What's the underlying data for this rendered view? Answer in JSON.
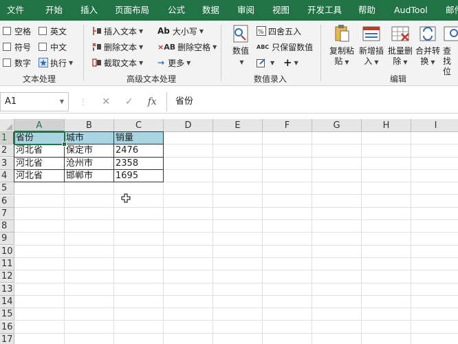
{
  "tabs": [
    "文件",
    "开始",
    "插入",
    "页面布局",
    "公式",
    "数据",
    "审阅",
    "视图",
    "开发工具",
    "帮助",
    "AudTool",
    "邮件"
  ],
  "ribbon": {
    "text_group": {
      "items": [
        "空格",
        "英文",
        "符号",
        "中文",
        "数字",
        "执行"
      ],
      "label": "文本处理"
    },
    "advanced_group": {
      "items": [
        "插入文本",
        "大小写",
        "删除文本",
        "删除空格",
        "截取文本",
        "更多"
      ],
      "label": "高级文本处理"
    },
    "input_group": {
      "big": "数值",
      "items": [
        "四舍五入",
        "只保留数值"
      ],
      "label": "数值录入"
    },
    "edit_group": {
      "buttons": [
        {
          "line1": "复制粘",
          "line2": "贴"
        },
        {
          "line1": "新增插",
          "line2": "入"
        },
        {
          "line1": "批量删",
          "line2": "除"
        },
        {
          "line1": "合并转",
          "line2": "换"
        },
        {
          "line1": "查找",
          "line2": "位"
        }
      ],
      "label": "编辑"
    }
  },
  "formula_bar": {
    "name_box": "A1",
    "cancel": "✕",
    "confirm": "✓",
    "fx": "fx",
    "content": "省份"
  },
  "sheet": {
    "columns": [
      "A",
      "B",
      "C",
      "D",
      "E",
      "F",
      "G",
      "H",
      "I"
    ],
    "rows": [
      "1",
      "2",
      "3",
      "4",
      "5",
      "6",
      "7",
      "8",
      "9",
      "10",
      "11",
      "12",
      "13",
      "14",
      "15",
      "16",
      "17"
    ],
    "data": [
      [
        "省份",
        "城市",
        "销量"
      ],
      [
        "河北省",
        "保定市",
        "2476"
      ],
      [
        "河北省",
        "沧州市",
        "2358"
      ],
      [
        "河北省",
        "邯郸市",
        "1695"
      ]
    ],
    "active_cell": "A1"
  },
  "colors": {
    "brand": "#217346",
    "header_fill": "#a9d5e3"
  }
}
